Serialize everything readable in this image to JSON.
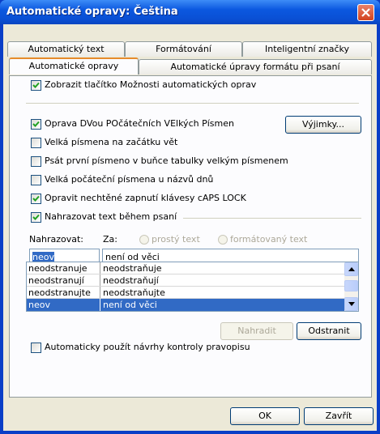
{
  "window": {
    "title": "Automatické opravy: Čeština"
  },
  "tabs_row1": [
    "Automatický text",
    "Formátování",
    "Inteligentní značky"
  ],
  "tabs_row2": [
    "Automatické opravy",
    "Automatické úpravy formátu při psaní"
  ],
  "options": {
    "show_button": {
      "label": "Zobrazit tlačítko Možnosti automatických oprav",
      "checked": true
    },
    "two_caps": {
      "label": "Oprava DVou POčátečních VElkých Písmen",
      "checked": true
    },
    "sentence_caps": {
      "label": "Velká písmena na začátku vět",
      "checked": false
    },
    "table_caps": {
      "label": "Psát první písmeno v buňce tabulky velkým písmenem",
      "checked": false
    },
    "day_names": {
      "label": "Velká počáteční písmena u názvů dnů",
      "checked": false
    },
    "caps_lock": {
      "label": "Opravit nechtěné zapnutí klávesy cAPS LOCK",
      "checked": true
    },
    "replace_text": {
      "label": "Nahrazovat text během psaní",
      "checked": true
    },
    "auto_spell": {
      "label": "Automaticky použít návrhy kontroly pravopisu",
      "checked": false
    }
  },
  "exceptions_button": "Výjimky...",
  "replace": {
    "replace_label": "Nahrazovat:",
    "with_label": "Za:",
    "plain_text": "prostý text",
    "formatted_text": "formátovaný text",
    "replace_value": "neov",
    "with_value": "není od věci"
  },
  "list": [
    {
      "from": "neodstranuje",
      "to": "neodstraňuje",
      "selected": false
    },
    {
      "from": "neodstranují",
      "to": "neodstraňují",
      "selected": false
    },
    {
      "from": "neodstranujte",
      "to": "neodstraňujte",
      "selected": false
    },
    {
      "from": "neov",
      "to": "není od věci",
      "selected": true
    }
  ],
  "buttons": {
    "replace": "Nahradit",
    "delete": "Odstranit",
    "ok": "OK",
    "cancel": "Zavřít"
  },
  "colors": {
    "title_bar": "#0a4fd3",
    "selection": "#316ac5",
    "tab_highlight": "#e68b2c",
    "dialog_bg": "#ece9d8"
  }
}
